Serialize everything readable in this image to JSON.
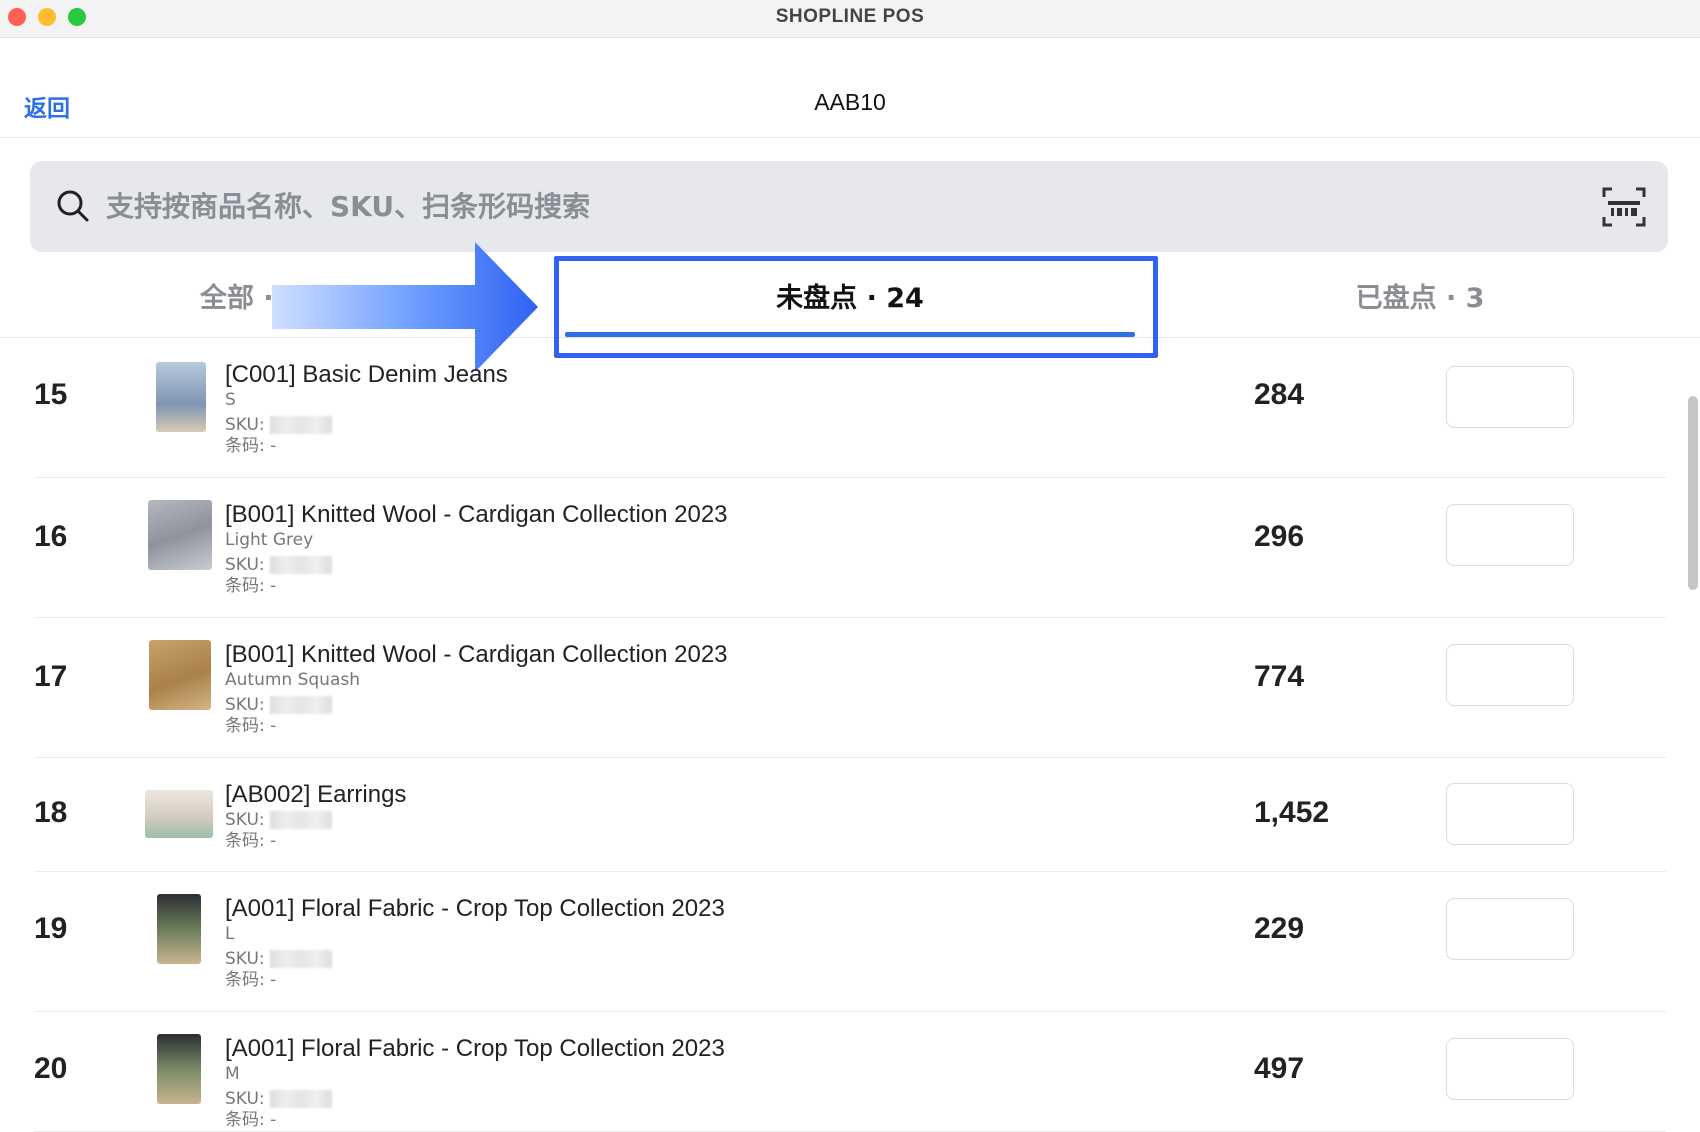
{
  "window": {
    "title": "SHOPLINE POS"
  },
  "header": {
    "back_label": "返回",
    "title": "AAB10"
  },
  "search": {
    "placeholder": "支持按商品名称、SKU、扫条形码搜索",
    "value": ""
  },
  "tabs": {
    "all": "全部 · 27",
    "uncounted": "未盘点 · 24",
    "counted": "已盘点 · 3",
    "selected": "uncounted"
  },
  "colors": {
    "accent": "#2d6fe6",
    "highlight": "#2f62f2"
  },
  "labels": {
    "sku": "SKU:",
    "barcode": "条码: -"
  },
  "items": [
    {
      "num": "15",
      "name": "[C001] Basic Denim Jeans",
      "variant": "S",
      "qty": "284"
    },
    {
      "num": "16",
      "name": "[B001] Knitted Wool - Cardigan Collection 2023",
      "variant": "Light Grey",
      "qty": "296"
    },
    {
      "num": "17",
      "name": "[B001] Knitted Wool - Cardigan Collection 2023",
      "variant": "Autumn Squash",
      "qty": "774"
    },
    {
      "num": "18",
      "name": "[AB002] Earrings",
      "variant": "",
      "qty": "1,452"
    },
    {
      "num": "19",
      "name": "[A001] Floral Fabric - Crop Top Collection 2023",
      "variant": "L",
      "qty": "229"
    },
    {
      "num": "20",
      "name": "[A001] Floral Fabric - Crop Top Collection 2023",
      "variant": "M",
      "qty": "497"
    }
  ]
}
